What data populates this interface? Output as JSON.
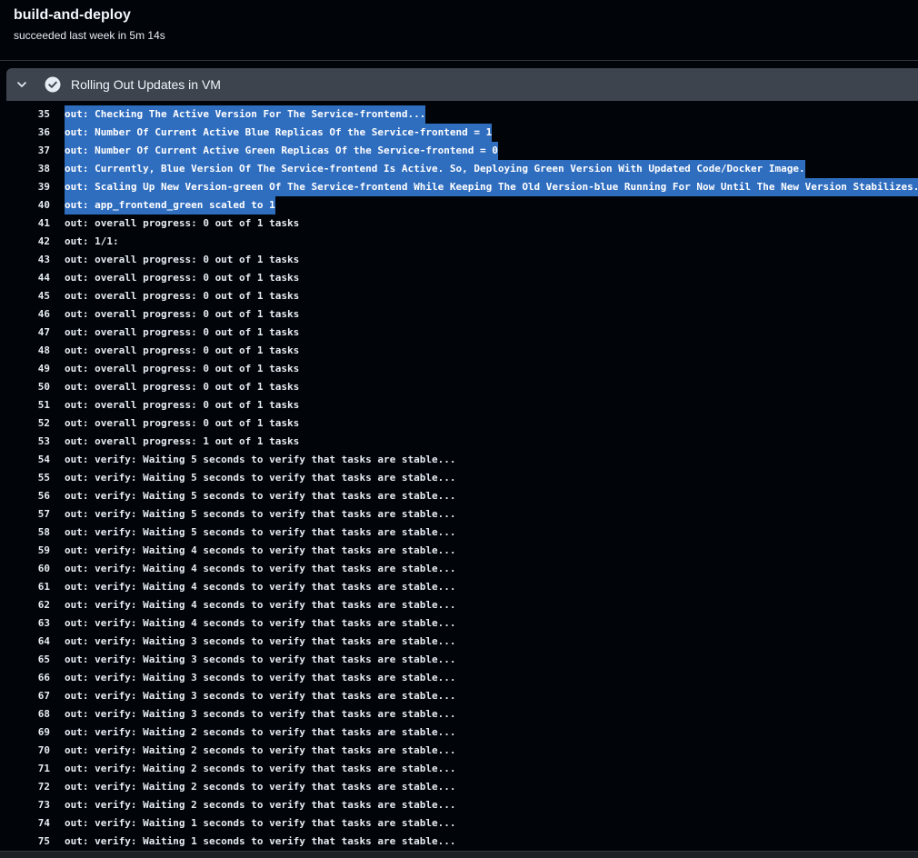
{
  "job": {
    "title": "build-and-deploy",
    "subtitle": "succeeded last week in 5m 14s"
  },
  "step": {
    "title": "Rolling Out Updates in VM",
    "status_icon": "check-circle-icon",
    "expand_icon": "chevron-down-icon"
  },
  "colors": {
    "background": "#010409",
    "step_header": "#3d444d",
    "selection": "#2f6dbf"
  },
  "log": [
    {
      "num": "35",
      "text": "out: Checking The Active Version For The Service-frontend...",
      "selected": true
    },
    {
      "num": "36",
      "text": "out: Number Of Current Active Blue Replicas Of the Service-frontend = 1",
      "selected": true
    },
    {
      "num": "37",
      "text": "out: Number Of Current Active Green Replicas Of the Service-frontend = 0",
      "selected": true
    },
    {
      "num": "38",
      "text": "out: Currently, Blue Version Of The Service-frontend Is Active. So, Deploying Green Version With Updated Code/Docker Image.",
      "selected": true
    },
    {
      "num": "39",
      "text": "out: Scaling Up New Version-green Of The Service-frontend While Keeping The Old Version-blue Running For Now Until The New Version Stabilizes.",
      "selected": true
    },
    {
      "num": "40",
      "text": "out: app_frontend_green scaled to 1",
      "selected": true
    },
    {
      "num": "41",
      "text": "out: overall progress: 0 out of 1 tasks",
      "selected": false
    },
    {
      "num": "42",
      "text": "out: 1/1:",
      "selected": false
    },
    {
      "num": "43",
      "text": "out: overall progress: 0 out of 1 tasks",
      "selected": false
    },
    {
      "num": "44",
      "text": "out: overall progress: 0 out of 1 tasks",
      "selected": false
    },
    {
      "num": "45",
      "text": "out: overall progress: 0 out of 1 tasks",
      "selected": false
    },
    {
      "num": "46",
      "text": "out: overall progress: 0 out of 1 tasks",
      "selected": false
    },
    {
      "num": "47",
      "text": "out: overall progress: 0 out of 1 tasks",
      "selected": false
    },
    {
      "num": "48",
      "text": "out: overall progress: 0 out of 1 tasks",
      "selected": false
    },
    {
      "num": "49",
      "text": "out: overall progress: 0 out of 1 tasks",
      "selected": false
    },
    {
      "num": "50",
      "text": "out: overall progress: 0 out of 1 tasks",
      "selected": false
    },
    {
      "num": "51",
      "text": "out: overall progress: 0 out of 1 tasks",
      "selected": false
    },
    {
      "num": "52",
      "text": "out: overall progress: 0 out of 1 tasks",
      "selected": false
    },
    {
      "num": "53",
      "text": "out: overall progress: 1 out of 1 tasks",
      "selected": false
    },
    {
      "num": "54",
      "text": "out: verify: Waiting 5 seconds to verify that tasks are stable...",
      "selected": false
    },
    {
      "num": "55",
      "text": "out: verify: Waiting 5 seconds to verify that tasks are stable...",
      "selected": false
    },
    {
      "num": "56",
      "text": "out: verify: Waiting 5 seconds to verify that tasks are stable...",
      "selected": false
    },
    {
      "num": "57",
      "text": "out: verify: Waiting 5 seconds to verify that tasks are stable...",
      "selected": false
    },
    {
      "num": "58",
      "text": "out: verify: Waiting 5 seconds to verify that tasks are stable...",
      "selected": false
    },
    {
      "num": "59",
      "text": "out: verify: Waiting 4 seconds to verify that tasks are stable...",
      "selected": false
    },
    {
      "num": "60",
      "text": "out: verify: Waiting 4 seconds to verify that tasks are stable...",
      "selected": false
    },
    {
      "num": "61",
      "text": "out: verify: Waiting 4 seconds to verify that tasks are stable...",
      "selected": false
    },
    {
      "num": "62",
      "text": "out: verify: Waiting 4 seconds to verify that tasks are stable...",
      "selected": false
    },
    {
      "num": "63",
      "text": "out: verify: Waiting 4 seconds to verify that tasks are stable...",
      "selected": false
    },
    {
      "num": "64",
      "text": "out: verify: Waiting 3 seconds to verify that tasks are stable...",
      "selected": false
    },
    {
      "num": "65",
      "text": "out: verify: Waiting 3 seconds to verify that tasks are stable...",
      "selected": false
    },
    {
      "num": "66",
      "text": "out: verify: Waiting 3 seconds to verify that tasks are stable...",
      "selected": false
    },
    {
      "num": "67",
      "text": "out: verify: Waiting 3 seconds to verify that tasks are stable...",
      "selected": false
    },
    {
      "num": "68",
      "text": "out: verify: Waiting 3 seconds to verify that tasks are stable...",
      "selected": false
    },
    {
      "num": "69",
      "text": "out: verify: Waiting 2 seconds to verify that tasks are stable...",
      "selected": false
    },
    {
      "num": "70",
      "text": "out: verify: Waiting 2 seconds to verify that tasks are stable...",
      "selected": false
    },
    {
      "num": "71",
      "text": "out: verify: Waiting 2 seconds to verify that tasks are stable...",
      "selected": false
    },
    {
      "num": "72",
      "text": "out: verify: Waiting 2 seconds to verify that tasks are stable...",
      "selected": false
    },
    {
      "num": "73",
      "text": "out: verify: Waiting 2 seconds to verify that tasks are stable...",
      "selected": false
    },
    {
      "num": "74",
      "text": "out: verify: Waiting 1 seconds to verify that tasks are stable...",
      "selected": false
    },
    {
      "num": "75",
      "text": "out: verify: Waiting 1 seconds to verify that tasks are stable...",
      "selected": false
    }
  ]
}
